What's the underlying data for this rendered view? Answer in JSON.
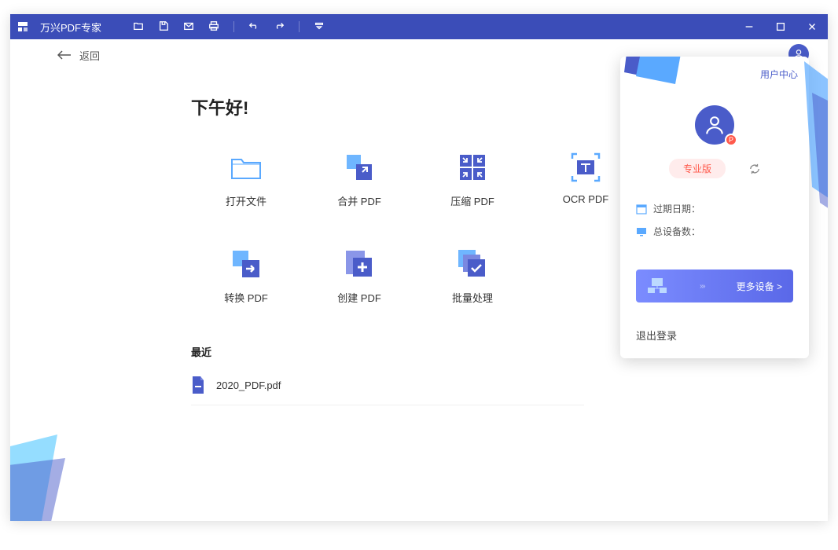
{
  "titlebar": {
    "app_title": "万兴PDF专家"
  },
  "back": {
    "label": "返回"
  },
  "greeting": "下午好!",
  "tiles": [
    {
      "label": "打开文件",
      "icon": "folder"
    },
    {
      "label": "合并 PDF",
      "icon": "merge"
    },
    {
      "label": "压缩 PDF",
      "icon": "compress"
    },
    {
      "label": "OCR PDF",
      "icon": "ocr"
    },
    {
      "label": "转换 PDF",
      "icon": "convert"
    },
    {
      "label": "创建 PDF",
      "icon": "create"
    },
    {
      "label": "批量处理",
      "icon": "batch"
    }
  ],
  "recent": {
    "title": "最近",
    "files": [
      {
        "name": "2020_PDF.pdf"
      }
    ]
  },
  "panel": {
    "user_center": "用户中心",
    "pro_label": "专业版",
    "avatar_badge": "P",
    "expire_label": "过期日期：",
    "devices_label": "总设备数：",
    "more_devices": "更多设备 >",
    "logout": "退出登录"
  }
}
